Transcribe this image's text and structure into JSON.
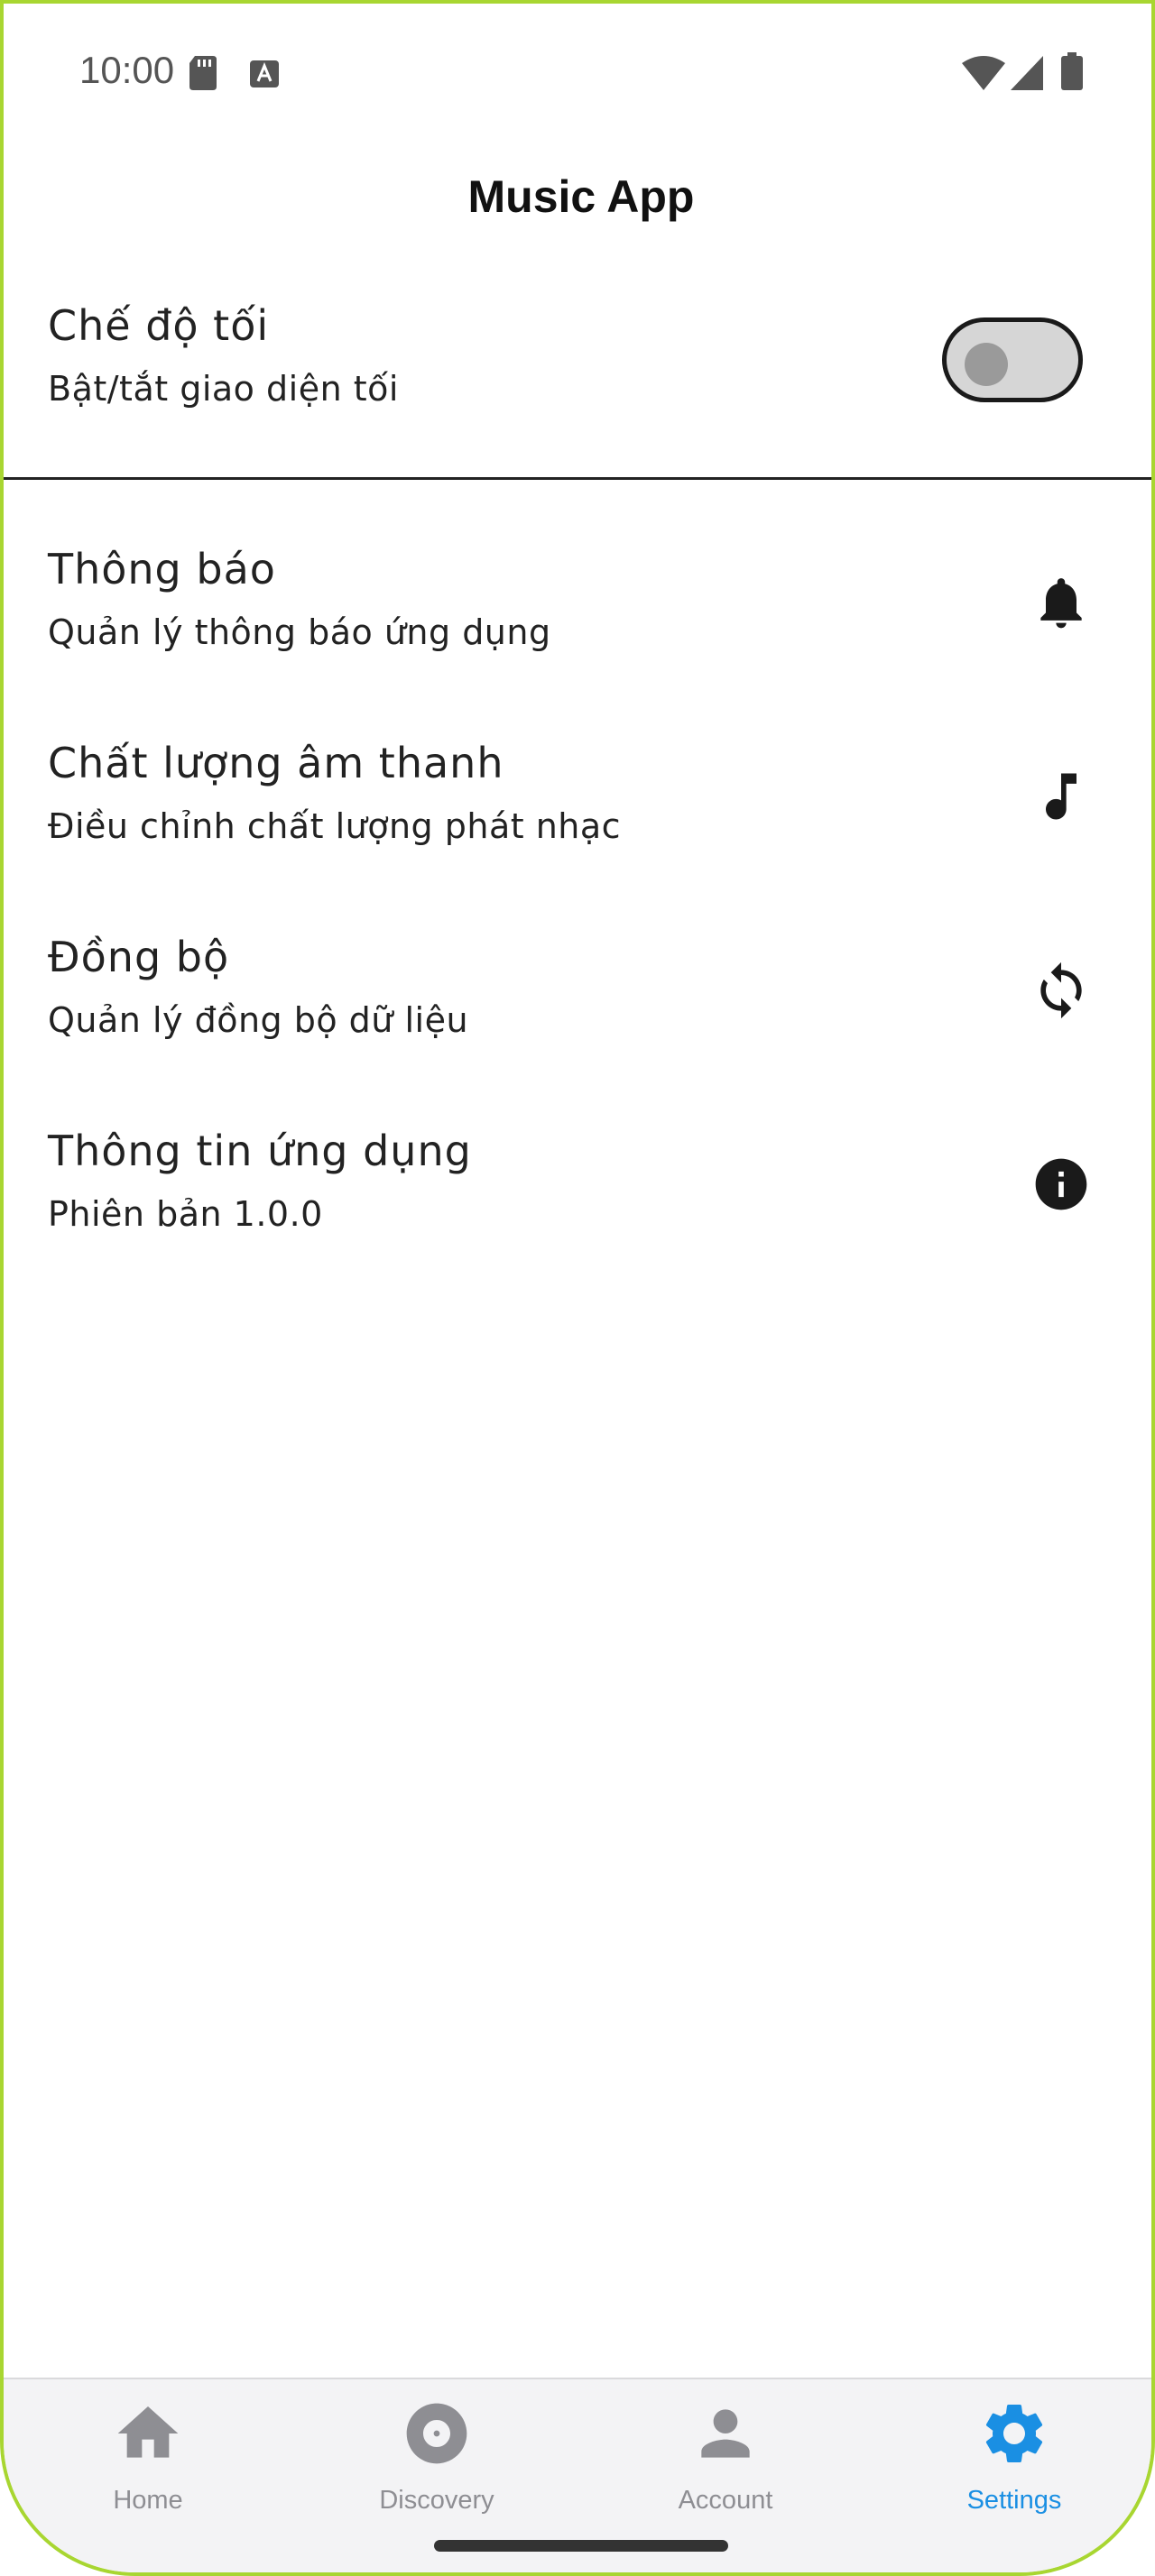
{
  "status_bar": {
    "time": "10:00",
    "icons": [
      "sd-card-icon",
      "keyboard-a-icon",
      "wifi-icon",
      "signal-icon",
      "battery-icon"
    ]
  },
  "app": {
    "title": "Music App"
  },
  "settings": {
    "dark_mode": {
      "title": "Chế độ tối",
      "subtitle": "Bật/tắt giao diện tối",
      "enabled": false
    },
    "items": [
      {
        "title": "Thông báo",
        "subtitle": "Quản lý thông báo ứng dụng",
        "icon": "bell-icon"
      },
      {
        "title": "Chất lượng âm thanh",
        "subtitle": "Điều chỉnh chất lượng phát nhạc",
        "icon": "music-note-icon"
      },
      {
        "title": "Đồng bộ",
        "subtitle": "Quản lý đồng bộ dữ liệu",
        "icon": "sync-icon"
      },
      {
        "title": "Thông tin ứng dụng",
        "subtitle": "Phiên bản 1.0.0",
        "icon": "info-icon"
      }
    ]
  },
  "bottom_nav": {
    "active": "Settings",
    "items": [
      {
        "label": "Home",
        "icon": "home-icon"
      },
      {
        "label": "Discovery",
        "icon": "disc-icon"
      },
      {
        "label": "Account",
        "icon": "person-icon"
      },
      {
        "label": "Settings",
        "icon": "gear-icon"
      }
    ]
  },
  "colors": {
    "accent": "#1a8fe3",
    "inactive": "#8e8e93",
    "device_frame": "#a8d631"
  }
}
